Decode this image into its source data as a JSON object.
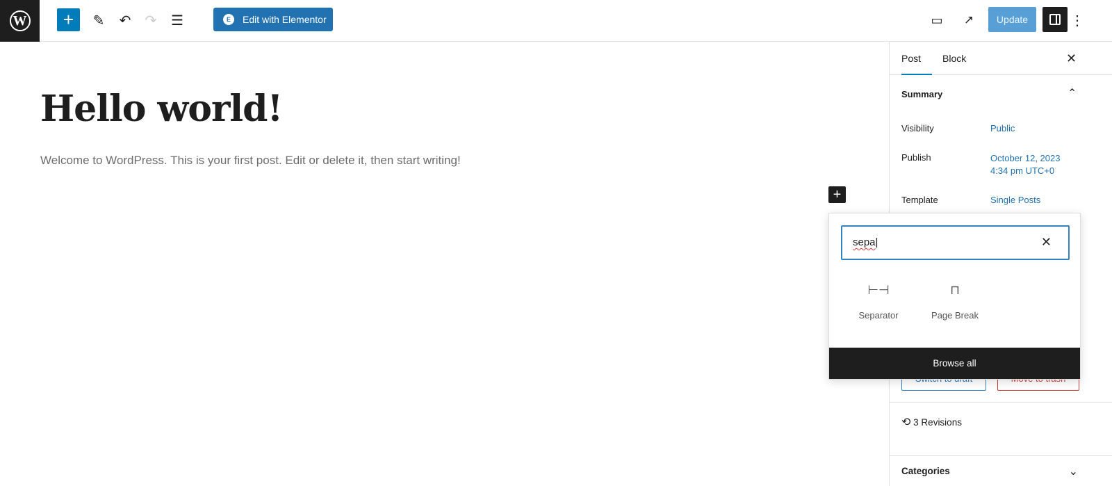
{
  "toolbar": {
    "elementor_label": "Edit with Elementor",
    "update_label": "Update"
  },
  "post": {
    "title": "Hello world!",
    "body": "Welcome to WordPress. This is your first post. Edit or delete it, then start writing!"
  },
  "sidebar": {
    "tabs": [
      "Post",
      "Block"
    ],
    "summary": "Summary",
    "visibility_label": "Visibility",
    "visibility_value": "Public",
    "publish_label": "Publish",
    "publish_date": "October 12, 2023",
    "publish_time": "4:34 pm UTC+0",
    "template_label": "Template",
    "template_value": "Single Posts",
    "switch_draft": "Switch to draft",
    "move_trash": "Move to trash",
    "revisions": "3 Revisions",
    "categories": "Categories"
  },
  "inserter": {
    "search_value": "sepa",
    "results": [
      {
        "label": "Separator",
        "icon": "separator-icon"
      },
      {
        "label": "Page Break",
        "icon": "page-break-icon"
      }
    ],
    "browse_all": "Browse all"
  },
  "colors": {
    "accent": "#007cba",
    "dark": "#1e1e1e",
    "danger": "#d63638"
  }
}
